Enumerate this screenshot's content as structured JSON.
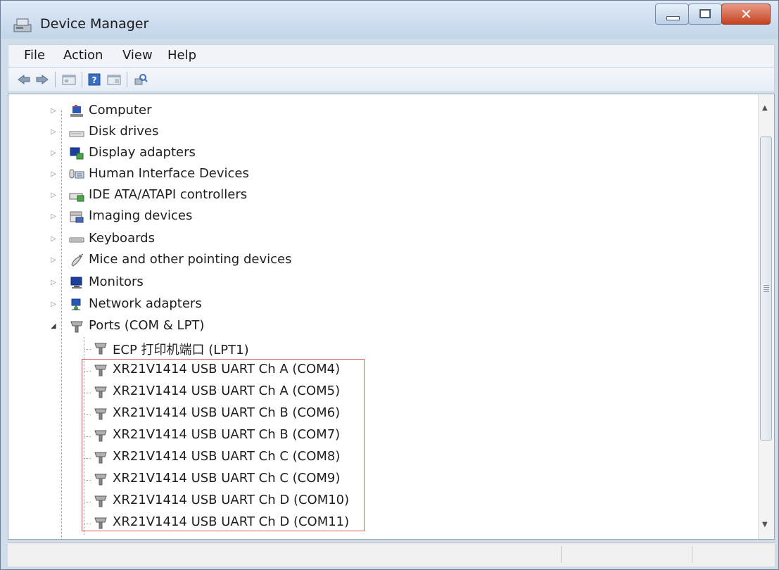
{
  "window": {
    "title": "Device Manager"
  },
  "menu": [
    {
      "label": "File"
    },
    {
      "label": "Action"
    },
    {
      "label": "View"
    },
    {
      "label": "Help"
    }
  ],
  "toolbar_icons": [
    "back-icon",
    "forward-icon",
    "properties-icon",
    "help-icon",
    "show-hide-tree-icon",
    "scan-hardware-icon"
  ],
  "tree": {
    "categories": [
      {
        "label": "Computer",
        "icon": "computer-icon"
      },
      {
        "label": "Disk drives",
        "icon": "disk-drive-icon"
      },
      {
        "label": "Display adapters",
        "icon": "display-adapter-icon"
      },
      {
        "label": "Human Interface Devices",
        "icon": "hid-icon"
      },
      {
        "label": "IDE ATA/ATAPI controllers",
        "icon": "ide-controller-icon"
      },
      {
        "label": "Imaging devices",
        "icon": "imaging-device-icon"
      },
      {
        "label": "Keyboards",
        "icon": "keyboard-icon"
      },
      {
        "label": "Mice and other pointing devices",
        "icon": "mouse-icon"
      },
      {
        "label": "Monitors",
        "icon": "monitor-icon"
      },
      {
        "label": "Network adapters",
        "icon": "network-adapter-icon"
      },
      {
        "label": "Ports (COM & LPT)",
        "icon": "port-icon",
        "expanded": true
      }
    ],
    "ports": [
      {
        "label": "ECP 打印机端口 (LPT1)"
      },
      {
        "label": "XR21V1414 USB UART Ch A (COM4)"
      },
      {
        "label": "XR21V1414 USB UART Ch A (COM5)"
      },
      {
        "label": "XR21V1414 USB UART Ch B (COM6)"
      },
      {
        "label": "XR21V1414 USB UART Ch B (COM7)"
      },
      {
        "label": "XR21V1414 USB UART Ch C (COM8)"
      },
      {
        "label": "XR21V1414 USB UART Ch C (COM9)"
      },
      {
        "label": "XR21V1414 USB UART Ch D (COM10)"
      },
      {
        "label": "XR21V1414 USB UART Ch D (COM11)"
      }
    ]
  },
  "colors": {
    "highlight_box": "#d96060",
    "title_bar": "#c3d5ea",
    "close_button": "#c4421f"
  }
}
